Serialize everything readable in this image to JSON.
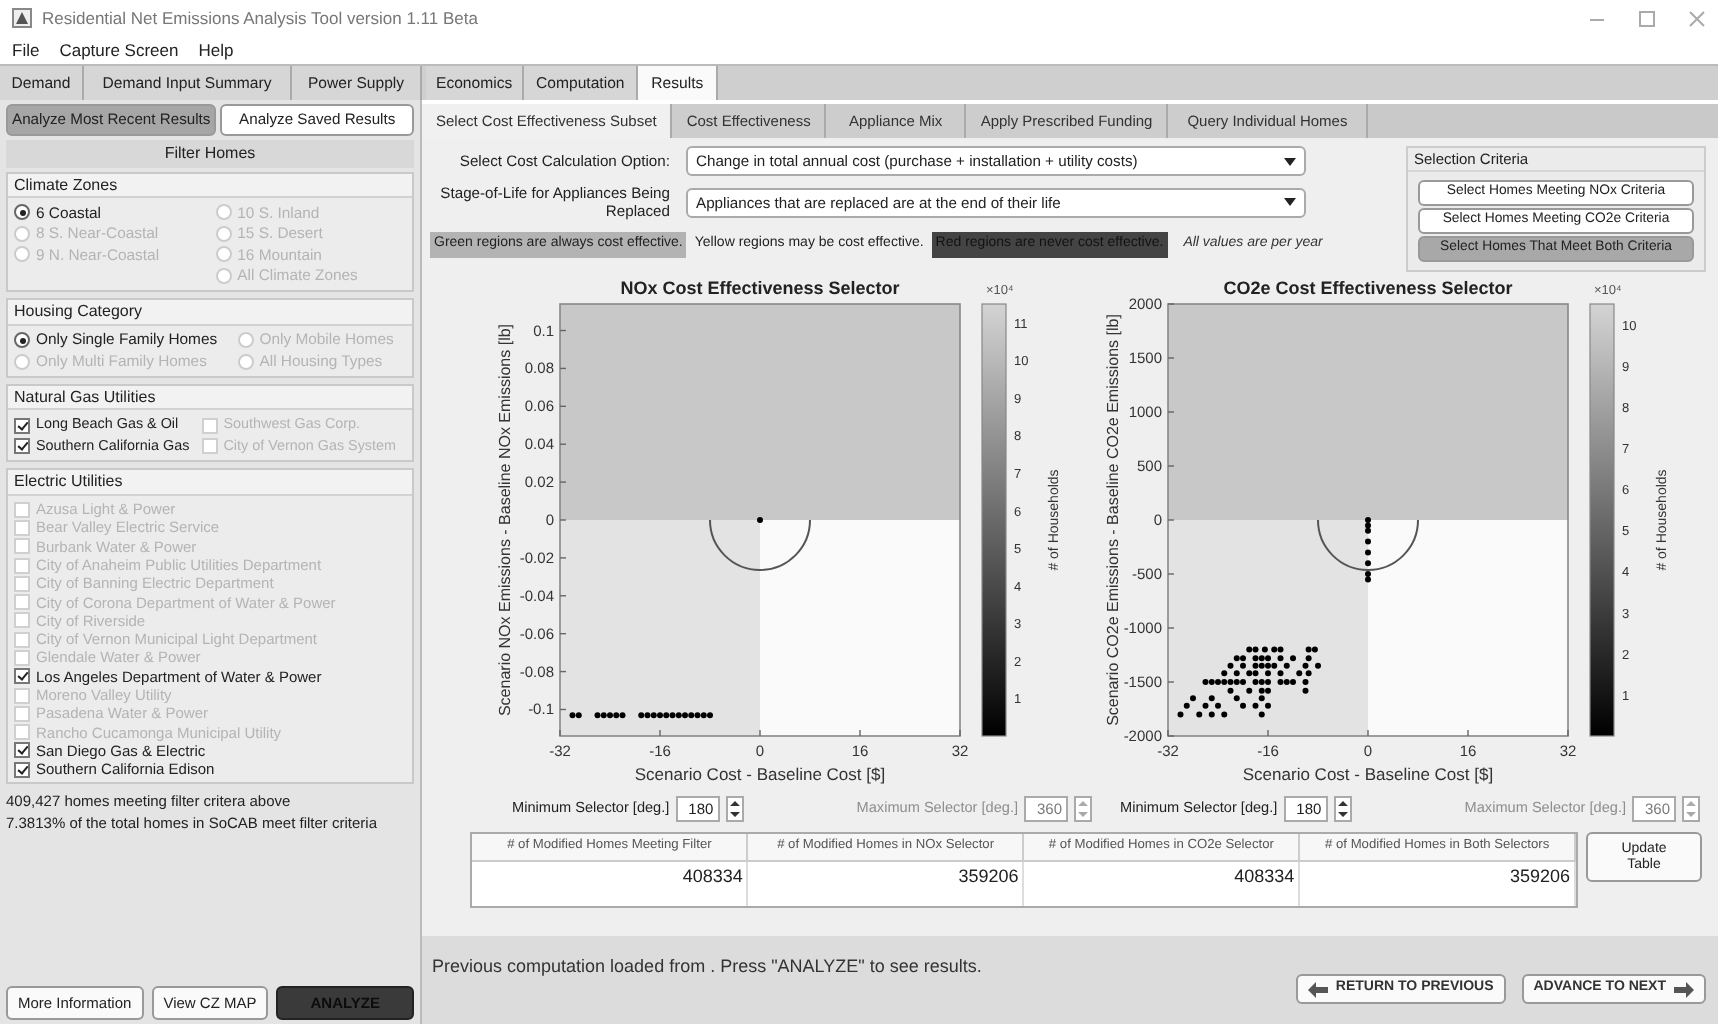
{
  "window": {
    "title": "Residential Net Emissions Analysis Tool version 1.11 Beta"
  },
  "menu": [
    "File",
    "Capture Screen",
    "Help"
  ],
  "tabs": [
    {
      "label": "Demand",
      "selected": false
    },
    {
      "label": "Demand Input Summary",
      "selected": false
    },
    {
      "label": "Power Supply",
      "selected": false
    },
    {
      "label": "Economics",
      "selected": false
    },
    {
      "label": "Computation",
      "selected": false
    },
    {
      "label": "Results",
      "selected": true
    }
  ],
  "left_panel": {
    "analyze_modes": [
      {
        "label": "Analyze Most Recent Results",
        "selected": true
      },
      {
        "label": "Analyze Saved Results",
        "selected": false
      }
    ],
    "filter_title": "Filter Homes",
    "groups": [
      {
        "title": "Climate Zones",
        "kind": "radio",
        "columns": [
          [
            {
              "label": "6 Coastal",
              "selected": true,
              "disabled": false
            },
            {
              "label": "8 S. Near-Coastal",
              "selected": false,
              "disabled": true
            },
            {
              "label": "9 N. Near-Coastal",
              "selected": false,
              "disabled": true
            }
          ],
          [
            {
              "label": "10 S. Inland",
              "selected": false,
              "disabled": true
            },
            {
              "label": "15 S. Desert",
              "selected": false,
              "disabled": true
            },
            {
              "label": "16 Mountain",
              "selected": false,
              "disabled": true
            },
            {
              "label": "All Climate Zones",
              "selected": false,
              "disabled": true
            }
          ]
        ]
      },
      {
        "title": "Housing Category",
        "kind": "radio",
        "columns": [
          [
            {
              "label": "Only Single Family Homes",
              "selected": true,
              "disabled": false
            },
            {
              "label": "Only Multi Family Homes",
              "selected": false,
              "disabled": true
            }
          ],
          [
            {
              "label": "Only Mobile Homes",
              "selected": false,
              "disabled": true
            },
            {
              "label": "All Housing Types",
              "selected": false,
              "disabled": true
            }
          ]
        ]
      },
      {
        "title": "Natural Gas Utilities",
        "kind": "checkbox",
        "columns": [
          [
            {
              "label": "Long Beach Gas & Oil",
              "checked": true,
              "disabled": false
            },
            {
              "label": "Southern California Gas",
              "checked": true,
              "disabled": false
            }
          ],
          [
            {
              "label": "Southwest Gas Corp.",
              "checked": false,
              "disabled": true
            },
            {
              "label": "City of Vernon Gas System",
              "checked": false,
              "disabled": true
            }
          ]
        ]
      },
      {
        "title": "Electric Utilities",
        "kind": "checkbox",
        "columns": [
          [
            {
              "label": "Azusa Light & Power",
              "checked": false,
              "disabled": true
            },
            {
              "label": "Bear Valley Electric Service",
              "checked": false,
              "disabled": true
            },
            {
              "label": "Burbank Water & Power",
              "checked": false,
              "disabled": true
            },
            {
              "label": "City of Anaheim Public Utilities Department",
              "checked": false,
              "disabled": true
            },
            {
              "label": "City of Banning Electric Department",
              "checked": false,
              "disabled": true
            },
            {
              "label": "City of Corona Department of Water & Power",
              "checked": false,
              "disabled": true
            },
            {
              "label": "City of Riverside",
              "checked": false,
              "disabled": true
            },
            {
              "label": "City of Vernon Municipal Light Department",
              "checked": false,
              "disabled": true
            },
            {
              "label": "Glendale Water & Power",
              "checked": false,
              "disabled": true
            },
            {
              "label": "Los Angeles Department of Water & Power",
              "checked": true,
              "disabled": false
            },
            {
              "label": "Moreno Valley Utility",
              "checked": false,
              "disabled": true
            },
            {
              "label": "Pasadena Water & Power",
              "checked": false,
              "disabled": true
            },
            {
              "label": "Rancho Cucamonga Municipal Utility",
              "checked": false,
              "disabled": true
            },
            {
              "label": "San Diego Gas & Electric",
              "checked": true,
              "disabled": false
            },
            {
              "label": "Southern California Edison",
              "checked": true,
              "disabled": false
            }
          ]
        ]
      }
    ],
    "summary": [
      "409,427 homes meeting filter critera above",
      "7.3813% of the total homes in SoCAB meet filter criteria"
    ],
    "buttons": [
      {
        "label": "More Information",
        "kind": "normal"
      },
      {
        "label": "View CZ MAP",
        "kind": "normal"
      },
      {
        "label": "ANALYZE",
        "kind": "dark"
      }
    ]
  },
  "sub_tabs": [
    {
      "label": "Select Cost Effectiveness Subset",
      "selected": true
    },
    {
      "label": "Cost Effectiveness",
      "selected": false
    },
    {
      "label": "Appliance Mix",
      "selected": false
    },
    {
      "label": "Apply Prescribed Funding",
      "selected": false
    },
    {
      "label": "Query Individual Homes",
      "selected": false
    }
  ],
  "options": [
    {
      "label": "Select Cost Calculation Option:",
      "value": "Change in total annual cost (purchase + installation + utility costs)"
    },
    {
      "label": "Stage-of-Life for Appliances Being Replaced",
      "value": "Appliances that are replaced are at the end of their life"
    }
  ],
  "legend": [
    {
      "text": "Green regions are always cost effective.",
      "kind": "green"
    },
    {
      "text": "Yellow regions may be cost effective.",
      "kind": "yellow"
    },
    {
      "text": "Red regions are never cost effective.",
      "kind": "red"
    }
  ],
  "legend_note": "All values are per year",
  "selection_criteria": {
    "title": "Selection Criteria",
    "buttons": [
      {
        "label": "Select Homes Meeting NOx Criteria",
        "selected": false
      },
      {
        "label": "Select Homes Meeting CO2e Criteria",
        "selected": false
      },
      {
        "label": "Select Homes That Meet Both Criteria",
        "selected": true
      }
    ]
  },
  "charts": [
    {
      "chart_data": {
        "type": "scatter",
        "title": "NOx Cost Effectiveness Selector",
        "xlabel": "Scenario Cost - Baseline Cost [$]",
        "ylabel": "Scenario NOx Emissions - Baseline NOx Emissions [lb]",
        "xlim": [
          -32,
          32
        ],
        "ylim": [
          -0.114,
          0.114
        ],
        "bands": [
          {
            "axis": "x",
            "from": -32,
            "to": 0,
            "color": "#e3e3e3"
          },
          {
            "axis": "x",
            "from": 0,
            "to": 32,
            "color": "#fafafa"
          },
          {
            "axis": "y",
            "from": 0,
            "to": 0.114,
            "color": "#c8c8c8"
          }
        ],
        "xticks": [
          -32,
          -16,
          0,
          16,
          32
        ],
        "yticks": [
          -0.1,
          -0.08,
          -0.06,
          -0.04,
          -0.02,
          0,
          0.02,
          0.04,
          0.06,
          0.08,
          0.1
        ],
        "x": [
          -30,
          -29,
          -26,
          -25,
          -24,
          -23,
          -22,
          -19,
          -18,
          -17,
          -16,
          -15,
          -14,
          -13,
          -12,
          -11,
          -10,
          -9,
          -8,
          0
        ],
        "series": [
          {
            "color": "#000000",
            "values": [
              -0.103,
              -0.103,
              -0.103,
              -0.103,
              -0.103,
              -0.103,
              -0.103,
              -0.103,
              -0.103,
              -0.103,
              -0.103,
              -0.103,
              -0.103,
              -0.103,
              -0.103,
              -0.103,
              -0.103,
              -0.103,
              -0.103,
              0
            ]
          }
        ]
      },
      "colorbar": {
        "label": "# of Households",
        "multiplier": "×10⁴",
        "ticks": [
          "11",
          "10",
          "9",
          "8",
          "7",
          "6",
          "5",
          "4",
          "3",
          "2",
          "1"
        ]
      },
      "min_selector": {
        "label": "Minimum Selector [deg.]",
        "value": "180",
        "disabled": false
      },
      "max_selector": {
        "label": "Maximum Selector [deg.]",
        "value": "360",
        "disabled": true
      }
    },
    {
      "chart_data": {
        "type": "scatter",
        "title": "CO2e Cost Effectiveness Selector",
        "xlabel": "Scenario Cost - Baseline Cost [$]",
        "ylabel": "Scenario CO2e Emissions - Baseline CO2e Emissions [lb]",
        "xlim": [
          -32,
          32
        ],
        "ylim": [
          -2000,
          2000
        ],
        "bands": [
          {
            "axis": "x",
            "from": -32,
            "to": 0,
            "color": "#e3e3e3"
          },
          {
            "axis": "x",
            "from": 0,
            "to": 32,
            "color": "#fafafa"
          },
          {
            "axis": "y",
            "from": 0,
            "to": 2000,
            "color": "#c8c8c8"
          }
        ],
        "xticks": [
          -32,
          -16,
          0,
          16,
          32
        ],
        "yticks": [
          -2000,
          -1500,
          -1000,
          -500,
          0,
          500,
          1000,
          1500,
          2000
        ],
        "x": [
          0,
          0,
          0,
          0,
          0,
          0,
          0,
          0,
          -19,
          -18,
          -16.5,
          -15,
          -14,
          -9.5,
          -8.5,
          -21,
          -20,
          -18,
          -17,
          -16,
          -14,
          -12,
          -9.5,
          -22,
          -20,
          -18,
          -17,
          -16,
          -15,
          -13,
          -10,
          -8,
          -23,
          -21,
          -19,
          -18,
          -16,
          -14,
          -11,
          -9.5,
          -26,
          -25,
          -24,
          -23,
          -22,
          -21,
          -20,
          -18,
          -17,
          -16,
          -14,
          -13,
          -12,
          -10,
          -22,
          -19,
          -17,
          -16,
          -10,
          -28,
          -25,
          -21,
          -17,
          -29,
          -26,
          -24,
          -20,
          -18,
          -16,
          -30,
          -27,
          -25,
          -23,
          -17
        ],
        "series": [
          {
            "color": "#000000",
            "values": [
              0,
              -50,
              -100,
              -200,
              -300,
              -400,
              -500,
              -550,
              -1200,
              -1200,
              -1200,
              -1200,
              -1200,
              -1200,
              -1200,
              -1280,
              -1280,
              -1280,
              -1280,
              -1280,
              -1280,
              -1280,
              -1280,
              -1350,
              -1350,
              -1350,
              -1350,
              -1350,
              -1350,
              -1350,
              -1350,
              -1350,
              -1420,
              -1420,
              -1420,
              -1420,
              -1420,
              -1420,
              -1420,
              -1420,
              -1500,
              -1500,
              -1500,
              -1500,
              -1500,
              -1500,
              -1500,
              -1500,
              -1500,
              -1500,
              -1500,
              -1500,
              -1500,
              -1500,
              -1580,
              -1580,
              -1580,
              -1580,
              -1580,
              -1650,
              -1650,
              -1650,
              -1650,
              -1720,
              -1720,
              -1720,
              -1720,
              -1720,
              -1720,
              -1800,
              -1800,
              -1800,
              -1800,
              -1800
            ]
          }
        ]
      },
      "colorbar": {
        "label": "# of Households",
        "multiplier": "×10⁴",
        "ticks": [
          "10",
          "9",
          "8",
          "7",
          "6",
          "5",
          "4",
          "3",
          "2",
          "1"
        ]
      },
      "min_selector": {
        "label": "Minimum Selector [deg.]",
        "value": "180",
        "disabled": false
      },
      "max_selector": {
        "label": "Maximum Selector [deg.]",
        "value": "360",
        "disabled": true
      }
    }
  ],
  "table": {
    "columns": [
      "# of Modified Homes Meeting Filter",
      "# of Modified Homes in NOx Selector",
      "# of Modified Homes in CO2e Selector",
      "# of Modified Homes in Both Selectors"
    ],
    "rows": [
      [
        "408334",
        "359206",
        "408334",
        "359206"
      ]
    ]
  },
  "update_button": "Update Table",
  "status": "Previous computation loaded from . Press \"ANALYZE\" to see results.",
  "nav_buttons": [
    {
      "label": "RETURN TO PREVIOUS",
      "kind": "back"
    },
    {
      "label": "ADVANCE TO NEXT",
      "kind": "next"
    }
  ]
}
